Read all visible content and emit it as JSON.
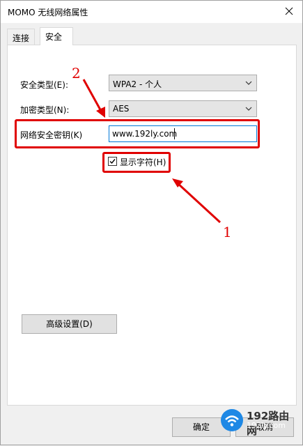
{
  "window": {
    "title": "MOMO 无线网络属性"
  },
  "tabs": [
    {
      "label": "连接",
      "active": false
    },
    {
      "label": "安全",
      "active": true
    }
  ],
  "security": {
    "security_type_label": "安全类型(E):",
    "security_type_value": "WPA2 - 个人",
    "encryption_type_label": "加密类型(N):",
    "encryption_type_value": "AES",
    "network_key_label": "网络安全密钥(K)",
    "network_key_value": "www.192ly.com",
    "show_characters_label": "显示字符(H)",
    "show_characters_checked": true,
    "advanced_button_label": "高级设置(D)"
  },
  "footer": {
    "ok_label": "确定",
    "cancel_label": "取消"
  },
  "annotations": {
    "marker_1": "1",
    "marker_2": "2",
    "color": "#e00000"
  },
  "watermark": {
    "text": "192路由网",
    "subtext": "192ly.com"
  }
}
